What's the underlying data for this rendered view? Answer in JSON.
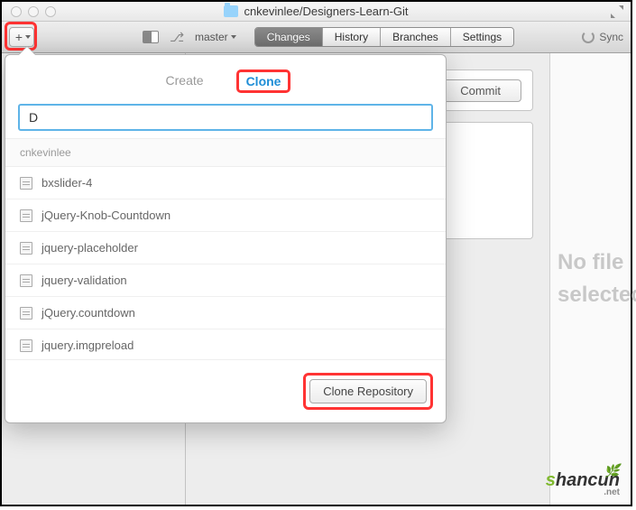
{
  "title": "cnkevinlee/Designers-Learn-Git",
  "toolbar": {
    "branch": "master",
    "tabs": [
      "Changes",
      "History",
      "Branches",
      "Settings"
    ],
    "active_tab": "Changes",
    "sync": "Sync"
  },
  "commit": {
    "button": "Commit"
  },
  "right": {
    "empty": "No file selected"
  },
  "popover": {
    "tabs": {
      "create": "Create",
      "clone": "Clone"
    },
    "active": "clone",
    "search_value": "D",
    "owner": "cnkevinlee",
    "repos": [
      "bxslider-4",
      "jQuery-Knob-Countdown",
      "jquery-placeholder",
      "jquery-validation",
      "jQuery.countdown",
      "jquery.imgpreload"
    ],
    "clone_button": "Clone Repository"
  },
  "watermark": {
    "text": "shancun",
    "suffix": ".net"
  }
}
